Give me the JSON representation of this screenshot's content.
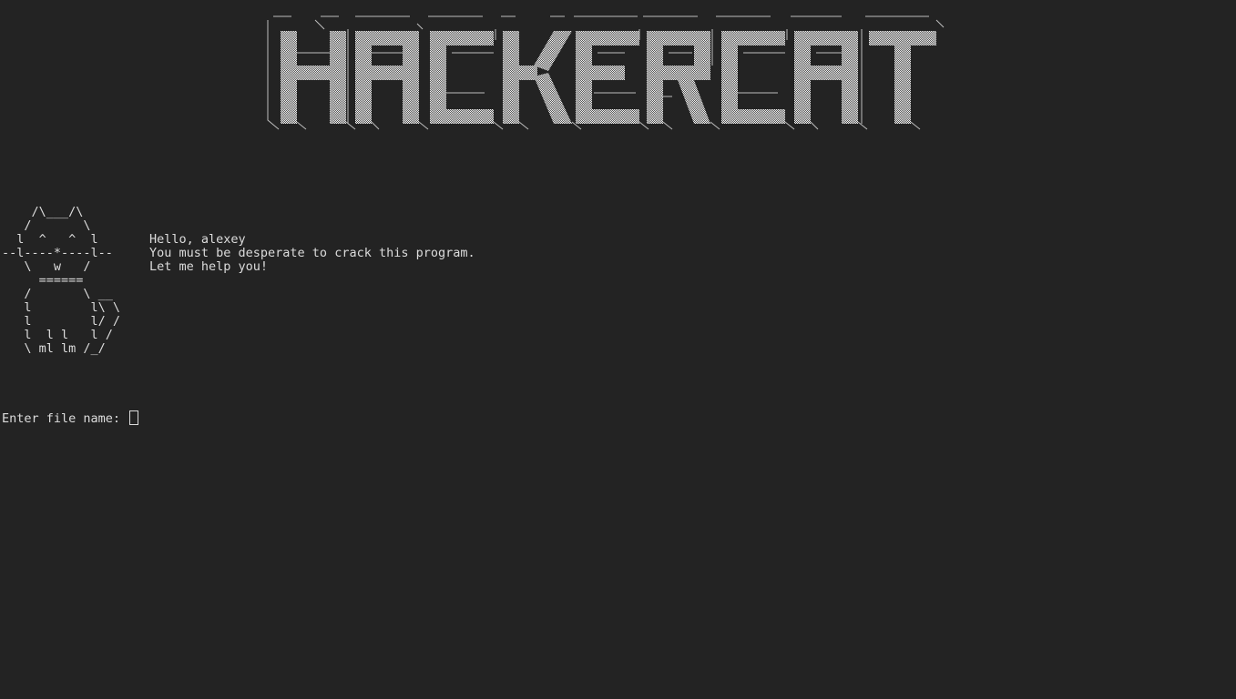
{
  "terminal": {
    "logo_text": "HACKERCAT",
    "cat_art": "    /\\___/\\\n   /       \\\n  l  ^   ^  l\n--l----*----l--\n   \\   w   /\n     ======\n   /       \\ __\n   l        l\\ \\\n   l        l/ /\n   l  l l   l /\n   \\ ml lm /_/",
    "greeting_lines": [
      "Hello, alexey",
      "You must be desperate to crack this program.",
      "Let me help you!"
    ],
    "prompt_label": "Enter file name: ",
    "input_value": ""
  },
  "colors": {
    "background": "#232323",
    "foreground": "#dcdcdc"
  }
}
